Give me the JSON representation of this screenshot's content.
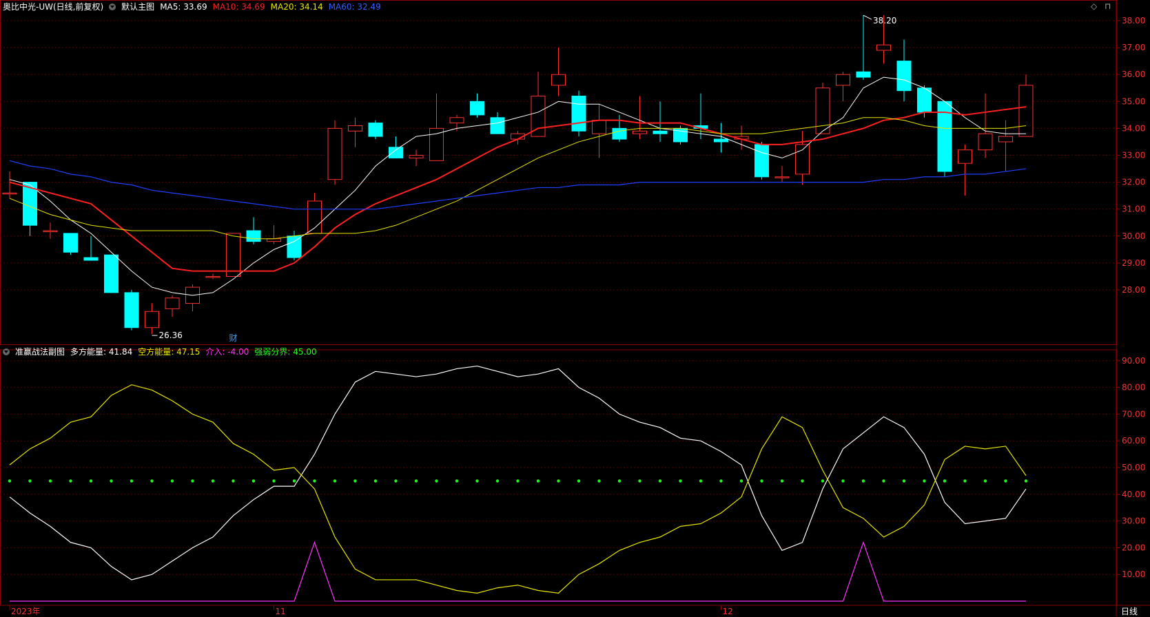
{
  "colors": {
    "bg": "#000000",
    "frame": "#8b0000",
    "up": "#ff3030",
    "down": "#00ffff",
    "ma5": "#ffffff",
    "ma10": "#ff2020",
    "ma20": "#e8e800",
    "ma60": "#1f3fff",
    "purple": "#ff30ff",
    "dots": "#20ff20"
  },
  "main_header": {
    "icon": "chevron-down-icon",
    "title": "奥比中光-UW(日线,前复权)",
    "chart_label": "默认主图",
    "ma5": "MA5: 33.69",
    "ma10": "MA10: 34.69",
    "ma20": "MA20: 34.14",
    "ma60": "MA60: 32.49"
  },
  "sub_header": {
    "icon": "chevron-down-icon",
    "title": "准赢战法副图",
    "long": "多方能量: 41.84",
    "short": "空方能量: 47.15",
    "enter": "介入: -4.00",
    "divide": "强弱分界: 45.00"
  },
  "controls": {
    "diamond": "◇",
    "collapse": "⊓"
  },
  "timeframe": "日线",
  "chart_data": [
    {
      "type": "candlestick",
      "x_labels": [
        "2023年",
        "11",
        "12"
      ],
      "x_label_index": [
        0,
        13,
        35
      ],
      "ylim": [
        26,
        38.4
      ],
      "y_ticks": [
        28,
        29,
        30,
        31,
        32,
        33,
        34,
        35,
        36,
        37,
        38
      ],
      "y_tick_labels": [
        "28.00",
        "29.00",
        "30.00",
        "31.00",
        "32.00",
        "33.00",
        "34.00",
        "35.00",
        "36.00",
        "37.00",
        "38.00"
      ],
      "annotations": {
        "high": "38.20",
        "high_index": 42,
        "high_value": 38.2,
        "low": "26.36",
        "low_index": 7,
        "low_value": 26.36,
        "marker": "财",
        "marker_index": 11
      },
      "ohlc": [
        [
          31.6,
          32.4,
          31.4,
          31.6
        ],
        [
          32.0,
          32.0,
          30.0,
          30.4
        ],
        [
          30.2,
          30.5,
          29.9,
          30.2
        ],
        [
          30.1,
          30.1,
          29.3,
          29.4
        ],
        [
          29.2,
          30.0,
          29.1,
          29.1
        ],
        [
          29.3,
          29.3,
          27.9,
          27.9
        ],
        [
          27.9,
          28.0,
          26.5,
          26.6
        ],
        [
          26.6,
          27.5,
          26.36,
          27.2
        ],
        [
          27.3,
          27.8,
          27.0,
          27.7
        ],
        [
          27.5,
          28.2,
          27.2,
          28.1
        ],
        [
          28.5,
          28.6,
          28.4,
          28.5
        ],
        [
          28.5,
          30.1,
          28.5,
          30.1
        ],
        [
          30.2,
          30.7,
          29.7,
          29.8
        ],
        [
          29.8,
          30.4,
          29.7,
          29.9
        ],
        [
          30.0,
          30.2,
          29.1,
          29.2
        ],
        [
          30.1,
          31.6,
          30.1,
          31.3
        ],
        [
          32.1,
          34.3,
          31.9,
          34.0
        ],
        [
          33.9,
          34.4,
          33.3,
          34.1
        ],
        [
          34.2,
          34.3,
          33.6,
          33.7
        ],
        [
          33.3,
          33.7,
          32.9,
          32.9
        ],
        [
          32.9,
          33.2,
          32.6,
          33.0
        ],
        [
          32.8,
          35.3,
          32.8,
          34.0
        ],
        [
          34.2,
          34.5,
          33.9,
          34.4
        ],
        [
          35.0,
          35.3,
          34.4,
          34.5
        ],
        [
          34.4,
          34.6,
          33.8,
          33.8
        ],
        [
          33.6,
          33.9,
          33.4,
          33.8
        ],
        [
          33.7,
          36.1,
          33.7,
          35.2
        ],
        [
          35.6,
          37.0,
          35.2,
          36.0
        ],
        [
          35.2,
          35.4,
          33.7,
          33.9
        ],
        [
          33.8,
          34.9,
          32.9,
          34.3
        ],
        [
          34.0,
          34.5,
          33.5,
          33.6
        ],
        [
          33.8,
          35.2,
          33.6,
          33.9
        ],
        [
          33.9,
          35.0,
          33.5,
          33.8
        ],
        [
          34.0,
          34.1,
          33.4,
          33.5
        ],
        [
          34.1,
          35.3,
          33.6,
          34.0
        ],
        [
          33.6,
          34.2,
          33.1,
          33.5
        ],
        [
          33.6,
          34.1,
          33.2,
          33.7
        ],
        [
          33.4,
          33.5,
          32.1,
          32.2
        ],
        [
          32.2,
          32.6,
          32.0,
          32.2
        ],
        [
          32.3,
          33.9,
          31.9,
          33.4
        ],
        [
          33.8,
          35.7,
          33.8,
          35.5
        ],
        [
          35.6,
          36.1,
          35.0,
          36.0
        ],
        [
          36.1,
          38.2,
          35.8,
          35.9
        ],
        [
          36.9,
          38.2,
          36.4,
          37.1
        ],
        [
          36.5,
          37.3,
          35.0,
          35.4
        ],
        [
          35.5,
          35.6,
          34.4,
          34.6
        ],
        [
          35.0,
          35.0,
          32.2,
          32.4
        ],
        [
          32.7,
          33.4,
          31.5,
          33.2
        ],
        [
          33.2,
          35.3,
          32.9,
          33.8
        ],
        [
          33.5,
          34.3,
          32.4,
          33.7
        ],
        [
          33.7,
          36.0,
          33.7,
          35.6
        ]
      ],
      "series": [
        {
          "name": "MA5",
          "values": [
            32.1,
            31.9,
            31.3,
            30.6,
            30.1,
            29.4,
            28.7,
            28.1,
            27.9,
            27.8,
            27.9,
            28.4,
            29.0,
            29.5,
            29.8,
            30.3,
            31.0,
            31.7,
            32.6,
            33.2,
            33.7,
            33.8,
            34.0,
            34.1,
            34.2,
            34.4,
            34.6,
            35.0,
            34.9,
            34.9,
            34.6,
            34.3,
            34.0,
            33.9,
            33.8,
            33.7,
            33.4,
            33.1,
            32.9,
            33.2,
            33.9,
            34.4,
            35.5,
            35.9,
            35.8,
            35.5,
            35.0,
            34.4,
            33.9,
            33.8,
            33.8
          ]
        },
        {
          "name": "MA10",
          "values": [
            32.0,
            31.8,
            31.6,
            31.4,
            31.2,
            30.6,
            30.0,
            29.4,
            28.8,
            28.7,
            28.7,
            28.7,
            28.7,
            28.7,
            29.0,
            29.6,
            30.3,
            30.8,
            31.2,
            31.5,
            31.8,
            32.1,
            32.5,
            32.9,
            33.3,
            33.6,
            34.0,
            34.1,
            34.2,
            34.3,
            34.3,
            34.2,
            34.2,
            34.2,
            34.0,
            33.8,
            33.6,
            33.4,
            33.4,
            33.5,
            33.6,
            33.8,
            34.0,
            34.3,
            34.4,
            34.6,
            34.6,
            34.5,
            34.6,
            34.7,
            34.8
          ]
        },
        {
          "name": "MA20",
          "values": [
            31.4,
            31.1,
            30.8,
            30.6,
            30.4,
            30.3,
            30.2,
            30.2,
            30.2,
            30.2,
            30.2,
            30.0,
            29.9,
            29.9,
            30.0,
            30.1,
            30.1,
            30.1,
            30.2,
            30.4,
            30.7,
            31.0,
            31.3,
            31.7,
            32.1,
            32.5,
            32.9,
            33.2,
            33.5,
            33.7,
            33.9,
            34.0,
            34.0,
            34.0,
            33.9,
            33.8,
            33.8,
            33.8,
            33.9,
            34.0,
            34.1,
            34.2,
            34.4,
            34.4,
            34.3,
            34.1,
            34.0,
            34.0,
            34.0,
            34.0,
            34.1
          ]
        },
        {
          "name": "MA60",
          "values": [
            32.8,
            32.6,
            32.5,
            32.3,
            32.2,
            32.0,
            31.9,
            31.7,
            31.6,
            31.5,
            31.4,
            31.3,
            31.2,
            31.1,
            31.0,
            31.0,
            31.0,
            31.0,
            31.0,
            31.1,
            31.2,
            31.3,
            31.4,
            31.5,
            31.6,
            31.7,
            31.8,
            31.8,
            31.9,
            31.9,
            31.9,
            32.0,
            32.0,
            32.0,
            32.0,
            32.0,
            32.0,
            32.0,
            32.0,
            32.0,
            32.0,
            32.0,
            32.0,
            32.1,
            32.1,
            32.2,
            32.2,
            32.3,
            32.3,
            32.4,
            32.5
          ]
        }
      ]
    },
    {
      "type": "line",
      "title": "准赢战法副图",
      "ylim": [
        0,
        95
      ],
      "y_ticks": [
        10,
        20,
        30,
        40,
        50,
        60,
        70,
        80,
        90
      ],
      "y_tick_labels": [
        "10.00",
        "20.00",
        "30.00",
        "40.00",
        "50.00",
        "60.00",
        "70.00",
        "80.00",
        "90.00"
      ],
      "series": [
        {
          "name": "多方能量",
          "values": [
            39,
            33,
            28,
            22,
            20,
            13,
            8,
            10,
            15,
            20,
            24,
            32,
            38,
            43,
            43,
            55,
            70,
            82,
            86,
            85,
            84,
            85,
            87,
            88,
            86,
            84,
            85,
            87,
            80,
            76,
            70,
            67,
            65,
            61,
            60,
            56,
            51,
            32,
            19,
            22,
            42,
            57,
            63,
            69,
            65,
            55,
            37,
            29,
            30,
            31,
            42
          ]
        },
        {
          "name": "空方能量",
          "values": [
            51,
            57,
            61,
            67,
            69,
            77,
            81,
            79,
            75,
            70,
            67,
            59,
            55,
            49,
            50,
            42,
            24,
            12,
            8,
            8,
            8,
            6,
            4,
            3,
            5,
            6,
            4,
            3,
            10,
            14,
            19,
            22,
            24,
            28,
            29,
            33,
            39,
            57,
            69,
            65,
            49,
            35,
            31,
            24,
            28,
            36,
            53,
            58,
            57,
            58,
            47
          ]
        },
        {
          "name": "介入",
          "values": [
            0,
            0,
            0,
            0,
            0,
            0,
            0,
            0,
            0,
            0,
            0,
            0,
            0,
            0,
            0,
            22,
            0,
            0,
            0,
            0,
            0,
            0,
            0,
            0,
            0,
            0,
            0,
            0,
            0,
            0,
            0,
            0,
            0,
            0,
            0,
            0,
            0,
            0,
            0,
            0,
            0,
            0,
            22,
            0,
            0,
            0,
            0,
            0,
            0,
            0,
            0
          ]
        },
        {
          "name": "强弱分界",
          "values": [
            45,
            45,
            45,
            45,
            45,
            45,
            45,
            45,
            45,
            45,
            45,
            45,
            45,
            45,
            45,
            45,
            45,
            45,
            45,
            45,
            45,
            45,
            45,
            45,
            45,
            45,
            45,
            45,
            45,
            45,
            45,
            45,
            45,
            45,
            45,
            45,
            45,
            45,
            45,
            45,
            45,
            45,
            45,
            45,
            45,
            45,
            45,
            45,
            45,
            45,
            45
          ]
        }
      ]
    }
  ]
}
